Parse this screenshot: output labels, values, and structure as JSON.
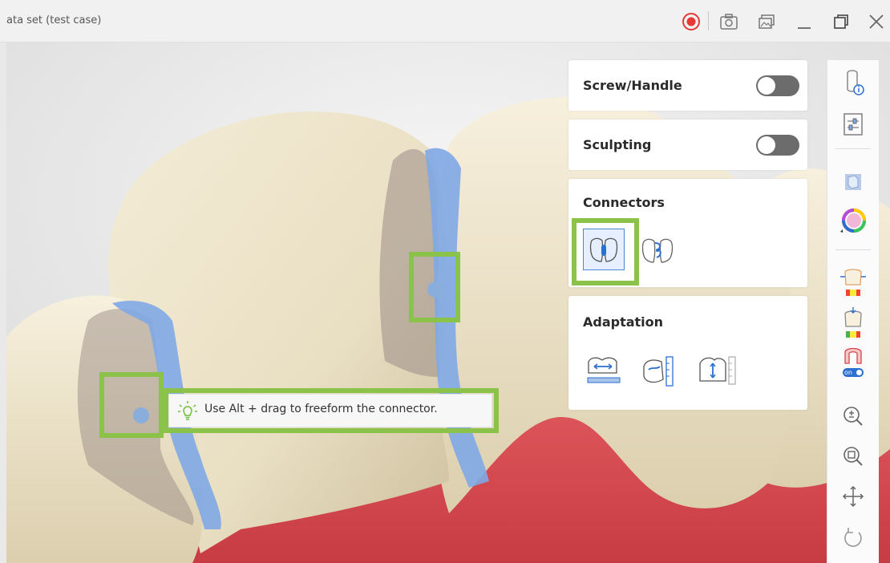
{
  "window": {
    "title": "ata set (test case)"
  },
  "panel": {
    "screw_handle": {
      "label": "Screw/Handle",
      "on": false
    },
    "sculpting": {
      "label": "Sculpting",
      "on": false
    },
    "connectors": {
      "label": "Connectors",
      "selected": "connector-tool-1"
    },
    "adaptation": {
      "label": "Adaptation"
    }
  },
  "tooltip": {
    "text": "Use Alt + drag to freeform the connector."
  },
  "badges": {
    "on": "on"
  },
  "colors": {
    "highlight": "#8bc34a",
    "tooth": "#ede4cc",
    "gum": "#d94a4f",
    "connector_blue": "#7fa8e6",
    "record_red": "#e53935"
  }
}
